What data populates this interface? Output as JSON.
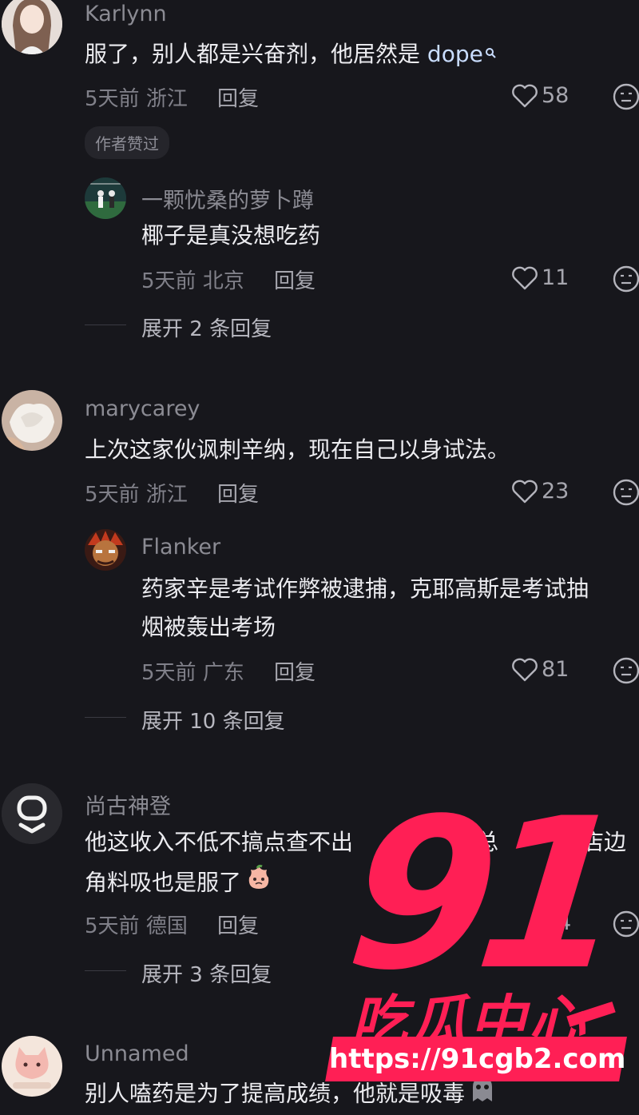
{
  "comments": [
    {
      "username": "Karlynn",
      "text": "服了，别人都是兴奋剂，他居然是",
      "link_text": "dope",
      "time": "5天前",
      "location": "浙江",
      "reply_label": "回复",
      "likes": "58",
      "badge": "作者赞过",
      "replies": [
        {
          "username": "一颗忧桑的萝卜蹲",
          "text": "椰子是真没想吃药",
          "time": "5天前",
          "location": "北京",
          "reply_label": "回复",
          "likes": "11"
        }
      ],
      "expand_label": "展开 2 条回复"
    },
    {
      "username": "marycarey",
      "text": "上次这家伙讽刺辛纳，现在自己以身试法。",
      "time": "5天前",
      "location": "浙江",
      "reply_label": "回复",
      "likes": "23",
      "replies": [
        {
          "username": "Flanker",
          "text_line1": "药家辛是考试作弊被逮捕，克耶高斯是考试抽",
          "text_line2": "烟被轰出考场",
          "time": "5天前",
          "location": "广东",
          "reply_label": "回复",
          "likes": "81"
        }
      ],
      "expand_label": "展开 10 条回复"
    },
    {
      "username": "尚古神登",
      "text_line1": "他这收入不低不搞点查不出",
      "text_line1_end": "总",
      "text_line1_tail": "饭店边",
      "text_line2": "角料吸也是服了",
      "time": "5天前",
      "location": "德国",
      "reply_label": "回复",
      "likes": "4",
      "expand_label": "展开 3 条回复"
    },
    {
      "username": "Unnamed",
      "text": "别人嗑药是为了提高成绩，他就是吸毒"
    }
  ],
  "watermark": {
    "number": "91",
    "title": "吃瓜中心",
    "url": "https://91cgb2.com"
  },
  "colors": {
    "background": "#17171c",
    "watermark": "#ff1f55",
    "link": "#c9ddff"
  }
}
